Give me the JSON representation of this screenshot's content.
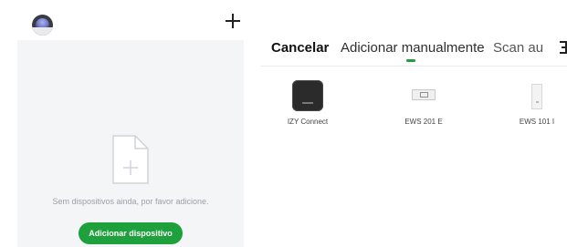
{
  "left_panel": {
    "add_icon": "plus-icon",
    "avatar_icon": "user-avatar",
    "empty_state": {
      "icon": "blank-file-plus-icon",
      "message": "Sem dispositivos ainda, por favor adicione.",
      "button_label": "Adicionar dispositivo"
    }
  },
  "right_panel": {
    "tabs": [
      {
        "label": "Cancelar"
      },
      {
        "label": "Adicionar manualmente"
      },
      {
        "label": "Scan au"
      }
    ],
    "active_tab": "Adicionar manualmente",
    "devices": [
      {
        "label": "IZY Connect",
        "icon": "hub-device-icon"
      },
      {
        "label": "EWS 201 E",
        "icon": "relay-module-icon"
      },
      {
        "label": "EWS 101 I",
        "icon": "wall-switch-icon"
      }
    ]
  },
  "colors": {
    "accent_green": "#1ea03c",
    "left_background": "#f4f5f7",
    "muted_text": "#9a9ea6"
  }
}
